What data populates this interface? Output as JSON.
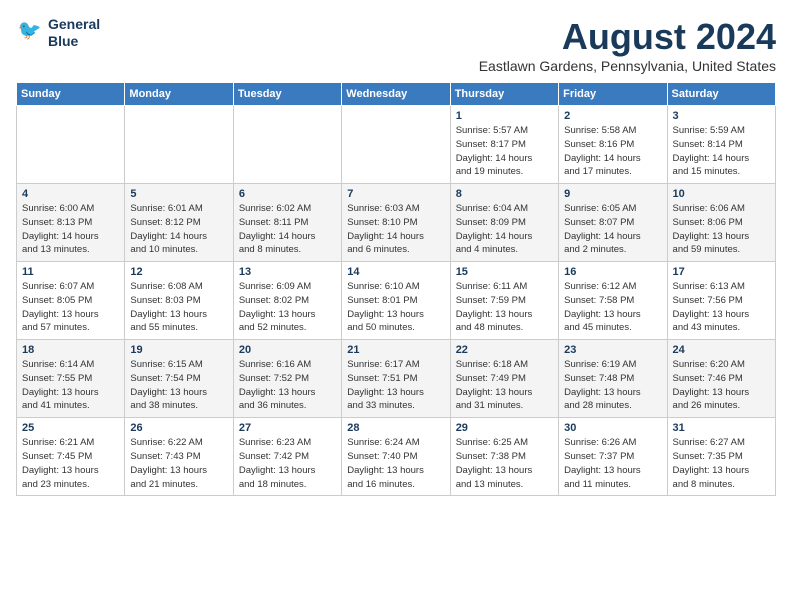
{
  "logo": {
    "line1": "General",
    "line2": "Blue"
  },
  "title": "August 2024",
  "subtitle": "Eastlawn Gardens, Pennsylvania, United States",
  "days_header": [
    "Sunday",
    "Monday",
    "Tuesday",
    "Wednesday",
    "Thursday",
    "Friday",
    "Saturday"
  ],
  "weeks": [
    [
      {
        "day": "",
        "info": ""
      },
      {
        "day": "",
        "info": ""
      },
      {
        "day": "",
        "info": ""
      },
      {
        "day": "",
        "info": ""
      },
      {
        "day": "1",
        "info": "Sunrise: 5:57 AM\nSunset: 8:17 PM\nDaylight: 14 hours\nand 19 minutes."
      },
      {
        "day": "2",
        "info": "Sunrise: 5:58 AM\nSunset: 8:16 PM\nDaylight: 14 hours\nand 17 minutes."
      },
      {
        "day": "3",
        "info": "Sunrise: 5:59 AM\nSunset: 8:14 PM\nDaylight: 14 hours\nand 15 minutes."
      }
    ],
    [
      {
        "day": "4",
        "info": "Sunrise: 6:00 AM\nSunset: 8:13 PM\nDaylight: 14 hours\nand 13 minutes."
      },
      {
        "day": "5",
        "info": "Sunrise: 6:01 AM\nSunset: 8:12 PM\nDaylight: 14 hours\nand 10 minutes."
      },
      {
        "day": "6",
        "info": "Sunrise: 6:02 AM\nSunset: 8:11 PM\nDaylight: 14 hours\nand 8 minutes."
      },
      {
        "day": "7",
        "info": "Sunrise: 6:03 AM\nSunset: 8:10 PM\nDaylight: 14 hours\nand 6 minutes."
      },
      {
        "day": "8",
        "info": "Sunrise: 6:04 AM\nSunset: 8:09 PM\nDaylight: 14 hours\nand 4 minutes."
      },
      {
        "day": "9",
        "info": "Sunrise: 6:05 AM\nSunset: 8:07 PM\nDaylight: 14 hours\nand 2 minutes."
      },
      {
        "day": "10",
        "info": "Sunrise: 6:06 AM\nSunset: 8:06 PM\nDaylight: 13 hours\nand 59 minutes."
      }
    ],
    [
      {
        "day": "11",
        "info": "Sunrise: 6:07 AM\nSunset: 8:05 PM\nDaylight: 13 hours\nand 57 minutes."
      },
      {
        "day": "12",
        "info": "Sunrise: 6:08 AM\nSunset: 8:03 PM\nDaylight: 13 hours\nand 55 minutes."
      },
      {
        "day": "13",
        "info": "Sunrise: 6:09 AM\nSunset: 8:02 PM\nDaylight: 13 hours\nand 52 minutes."
      },
      {
        "day": "14",
        "info": "Sunrise: 6:10 AM\nSunset: 8:01 PM\nDaylight: 13 hours\nand 50 minutes."
      },
      {
        "day": "15",
        "info": "Sunrise: 6:11 AM\nSunset: 7:59 PM\nDaylight: 13 hours\nand 48 minutes."
      },
      {
        "day": "16",
        "info": "Sunrise: 6:12 AM\nSunset: 7:58 PM\nDaylight: 13 hours\nand 45 minutes."
      },
      {
        "day": "17",
        "info": "Sunrise: 6:13 AM\nSunset: 7:56 PM\nDaylight: 13 hours\nand 43 minutes."
      }
    ],
    [
      {
        "day": "18",
        "info": "Sunrise: 6:14 AM\nSunset: 7:55 PM\nDaylight: 13 hours\nand 41 minutes."
      },
      {
        "day": "19",
        "info": "Sunrise: 6:15 AM\nSunset: 7:54 PM\nDaylight: 13 hours\nand 38 minutes."
      },
      {
        "day": "20",
        "info": "Sunrise: 6:16 AM\nSunset: 7:52 PM\nDaylight: 13 hours\nand 36 minutes."
      },
      {
        "day": "21",
        "info": "Sunrise: 6:17 AM\nSunset: 7:51 PM\nDaylight: 13 hours\nand 33 minutes."
      },
      {
        "day": "22",
        "info": "Sunrise: 6:18 AM\nSunset: 7:49 PM\nDaylight: 13 hours\nand 31 minutes."
      },
      {
        "day": "23",
        "info": "Sunrise: 6:19 AM\nSunset: 7:48 PM\nDaylight: 13 hours\nand 28 minutes."
      },
      {
        "day": "24",
        "info": "Sunrise: 6:20 AM\nSunset: 7:46 PM\nDaylight: 13 hours\nand 26 minutes."
      }
    ],
    [
      {
        "day": "25",
        "info": "Sunrise: 6:21 AM\nSunset: 7:45 PM\nDaylight: 13 hours\nand 23 minutes."
      },
      {
        "day": "26",
        "info": "Sunrise: 6:22 AM\nSunset: 7:43 PM\nDaylight: 13 hours\nand 21 minutes."
      },
      {
        "day": "27",
        "info": "Sunrise: 6:23 AM\nSunset: 7:42 PM\nDaylight: 13 hours\nand 18 minutes."
      },
      {
        "day": "28",
        "info": "Sunrise: 6:24 AM\nSunset: 7:40 PM\nDaylight: 13 hours\nand 16 minutes."
      },
      {
        "day": "29",
        "info": "Sunrise: 6:25 AM\nSunset: 7:38 PM\nDaylight: 13 hours\nand 13 minutes."
      },
      {
        "day": "30",
        "info": "Sunrise: 6:26 AM\nSunset: 7:37 PM\nDaylight: 13 hours\nand 11 minutes."
      },
      {
        "day": "31",
        "info": "Sunrise: 6:27 AM\nSunset: 7:35 PM\nDaylight: 13 hours\nand 8 minutes."
      }
    ]
  ]
}
